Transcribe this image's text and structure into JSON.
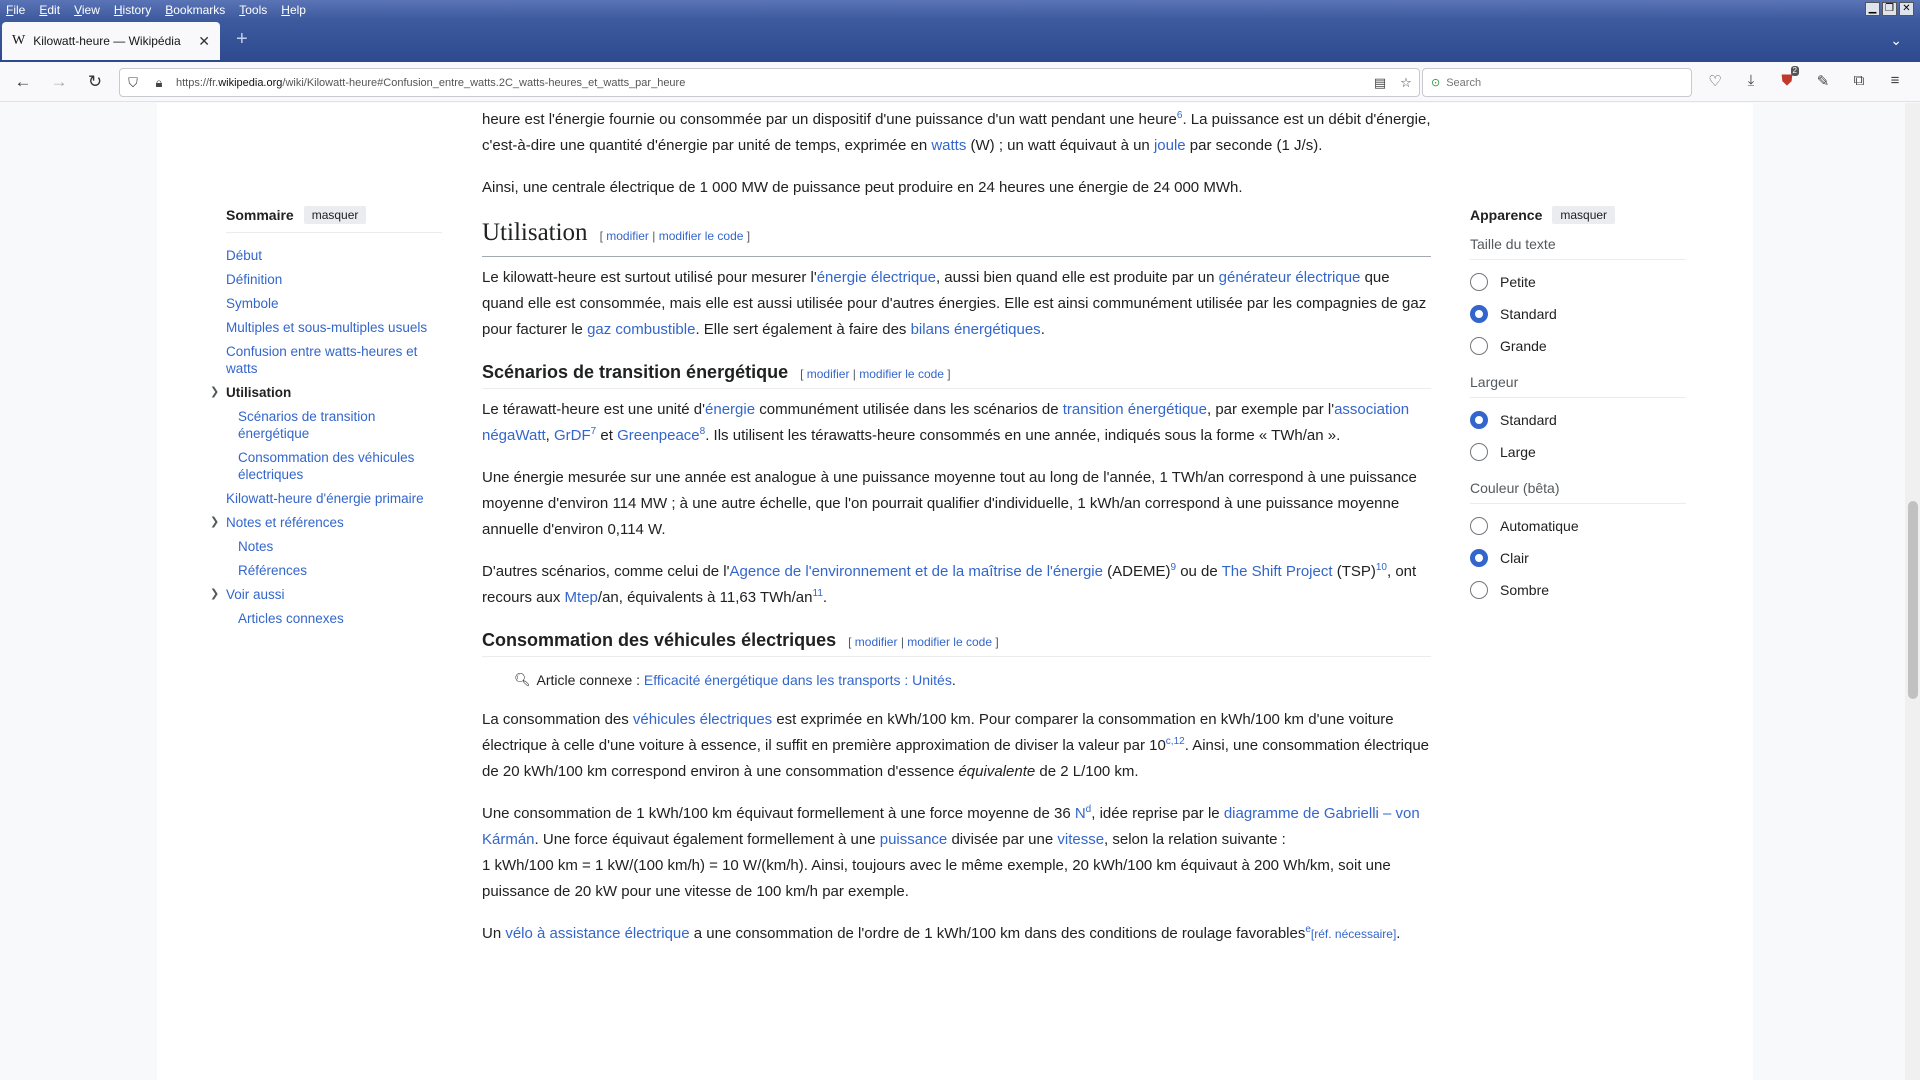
{
  "menubar": {
    "items": [
      {
        "mnem": "F",
        "rest": "ile"
      },
      {
        "mnem": "E",
        "rest": "dit"
      },
      {
        "mnem": "V",
        "rest": "iew"
      },
      {
        "mnem": "H",
        "rest": "istory"
      },
      {
        "mnem": "B",
        "rest": "ookmarks"
      },
      {
        "mnem": "T",
        "rest": "ools"
      },
      {
        "mnem": "H",
        "rest": "elp"
      }
    ]
  },
  "tab": {
    "favicon": "W",
    "title": "Kilowatt-heure — Wikipédia",
    "close": "✕",
    "new_tab": "+"
  },
  "navbar": {
    "url_prefix": "https://fr.",
    "url_host": "wikipedia.org",
    "url_path": "/wiki/Kilowatt-heure#Confusion_entre_watts.2C_watts-heures_et_watts_par_heure",
    "search_placeholder": "Search",
    "badge_count": "2"
  },
  "toc": {
    "title": "Sommaire",
    "hide_label": "masquer",
    "items": [
      {
        "label": "Début"
      },
      {
        "label": "Définition"
      },
      {
        "label": "Symbole"
      },
      {
        "label": "Multiples et sous-multiples usuels"
      },
      {
        "label": "Confusion entre watts-heures et watts"
      },
      {
        "label": "Utilisation"
      },
      {
        "label": "Scénarios de transition énergétique"
      },
      {
        "label": "Consommation des véhicules électriques"
      },
      {
        "label": "Kilowatt-heure d'énergie primaire"
      },
      {
        "label": "Notes et références"
      },
      {
        "label": "Notes"
      },
      {
        "label": "Références"
      },
      {
        "label": "Voir aussi"
      },
      {
        "label": "Articles connexes"
      }
    ]
  },
  "appearance": {
    "title": "Apparence",
    "hide_label": "masquer",
    "text_size_label": "Taille du texte",
    "text_size_options": [
      "Petite",
      "Standard",
      "Grande"
    ],
    "text_size_selected": "Standard",
    "width_label": "Largeur",
    "width_options": [
      "Standard",
      "Large"
    ],
    "width_selected": "Standard",
    "color_label": "Couleur (bêta)",
    "color_options": [
      "Automatique",
      "Clair",
      "Sombre"
    ],
    "color_selected": "Clair"
  },
  "article": {
    "p0": {
      "t1": "heure est l'énergie fournie ou consommée par un dispositif d'une puissance d'un watt pendant une heure",
      "r1": "6",
      "t2": ". La puissance est un débit d'énergie, c'est-à-dire une quantité d'énergie par unité de temps, exprimée en ",
      "l1": "watts",
      "t3": " (W) ; un watt équivaut à un ",
      "l2": "joule",
      "t4": " par seconde (1 J/s)."
    },
    "p1": "Ainsi, une centrale électrique de 1 000 MW de puissance peut produire en 24 heures une énergie de 24 000 MWh.",
    "h_utilisation": "Utilisation",
    "edit": {
      "open": "[ ",
      "modifier": "modifier",
      "sep": " | ",
      "modifier_code": "modifier le code",
      "close": " ]"
    },
    "p2": {
      "t1": "Le kilowatt-heure est surtout utilisé pour mesurer l'",
      "l1": "énergie électrique",
      "t2": ", aussi bien quand elle est produite par un ",
      "l2": "générateur électrique",
      "t3": " que quand elle est consommée, mais elle est aussi utilisée pour d'autres énergies. Elle est ainsi communément utilisée par les compagnies de gaz pour facturer le ",
      "l3": "gaz combustible",
      "t4": ". Elle sert également à faire des ",
      "l4": "bilans énergétiques",
      "t5": "."
    },
    "h_scenarios": "Scénarios de transition énergétique",
    "p3": {
      "t1": "Le térawatt-heure est une unité d'",
      "l1": "énergie",
      "t2": " communément utilisée dans les scénarios de ",
      "l2": "transition énergétique",
      "t3": ", par exemple par l'",
      "l3": "association négaWatt",
      "t4": ", ",
      "l4": "GrDF",
      "r1": "7",
      "t5": " et ",
      "l5": "Greenpeace",
      "r2": "8",
      "t6": ". Ils utilisent les térawatts-heure consommés en une année, indiqués sous la forme « TWh/an »."
    },
    "p4": "Une énergie mesurée sur une année est analogue à une puissance moyenne tout au long de l'année, 1 TWh/an correspond à une puissance moyenne d'environ 114 MW ; à une autre échelle, que l'on pourrait qualifier d'individuelle, 1 kWh/an correspond à une puissance moyenne annuelle d'environ 0,114 W.",
    "p5": {
      "t1": "D'autres scénarios, comme celui de l'",
      "l1": "Agence de l'environnement et de la maîtrise de l'énergie",
      "t2": " (ADEME)",
      "r1": "9",
      "t3": " ou de ",
      "l2": "The Shift Project",
      "t4": " (TSP)",
      "r2": "10",
      "t5": ", ont recours aux ",
      "l3": "Mtep",
      "t6": "/an, équivalents à 11,63 TWh/an",
      "r3": "11",
      "t7": "."
    },
    "h_conso": "Consommation des véhicules électriques",
    "hatnote": {
      "prefix": "Article connexe : ",
      "link": "Efficacité énergétique dans les transports : Unités",
      "suffix": "."
    },
    "p6": {
      "t1": "La consommation des ",
      "l1": "véhicules électriques",
      "t2": " est exprimée en kWh/100 km. Pour comparer la consommation en kWh/100 km d'une voiture électrique à celle d'une voiture à essence, il suffit en première approximation de diviser la valeur par 10",
      "r1": "c,12",
      "t3": ". Ainsi, une consommation électrique de 20 kWh/100 km correspond environ à une consommation d'essence ",
      "em": "équivalente",
      "t4": " de 2 L/100 km."
    },
    "p7": {
      "t1": "Une consommation de 1 kWh/100 km équivaut formellement à une force moyenne de 36 ",
      "l1": "N",
      "r1": "d",
      "t2": ", idée reprise par le ",
      "l2": "diagramme de Gabrielli – von Kármán",
      "t3": ". Une force équivaut également formellement à une ",
      "l3": "puissance",
      "t4": " divisée par une ",
      "l4": "vitesse",
      "t5": ", selon la relation suivante :",
      "formula": "1 kWh/100 km = 1 kW/(100 km/h) = 10 W/(km/h)",
      "t6": ". Ainsi, toujours avec le même exemple, 20 kWh/100 km équivaut à 200 Wh/km, soit une puissance de 20 kW pour une vitesse de 100 km/h par exemple."
    },
    "p8": {
      "t1": "Un ",
      "l1": "vélo à assistance électrique",
      "t2": " a une consommation de l'ordre de 1 kWh/100 km dans des conditions de roulage favorables",
      "r1": "e",
      "l2": "[réf. nécessaire]",
      "t3": "."
    }
  }
}
